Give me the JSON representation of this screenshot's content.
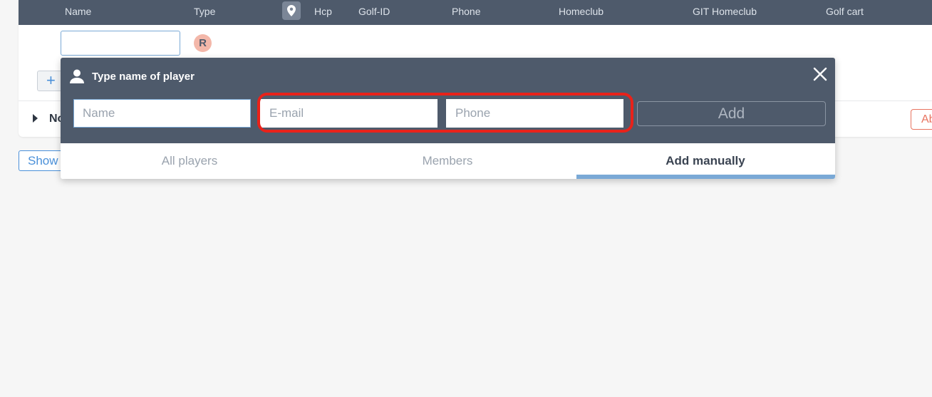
{
  "table": {
    "columns": [
      "Name",
      "Type",
      "Hcp",
      "Golf-ID",
      "Phone",
      "Homeclub",
      "GIT Homeclub",
      "Golf cart"
    ],
    "location_icon": "location-pin-icon",
    "player_badge": "R",
    "section_label": "No",
    "right_button_label": "Ab",
    "add_icon": "+",
    "show_button_label": "Show"
  },
  "popup": {
    "title": "Type name of player",
    "title_icon": "user-icon",
    "close_icon": "close-icon",
    "fields": {
      "name_placeholder": "Name",
      "email_placeholder": "E-mail",
      "phone_placeholder": "Phone"
    },
    "add_label": "Add",
    "tabs": [
      "All players",
      "Members",
      "Add manually"
    ],
    "active_tab": "Add manually",
    "highlight_color": "#e8221a"
  },
  "colors": {
    "header_bg": "#4e5a6b",
    "accent": "#7aa9d6",
    "badge_bg": "#f3b7a9"
  }
}
